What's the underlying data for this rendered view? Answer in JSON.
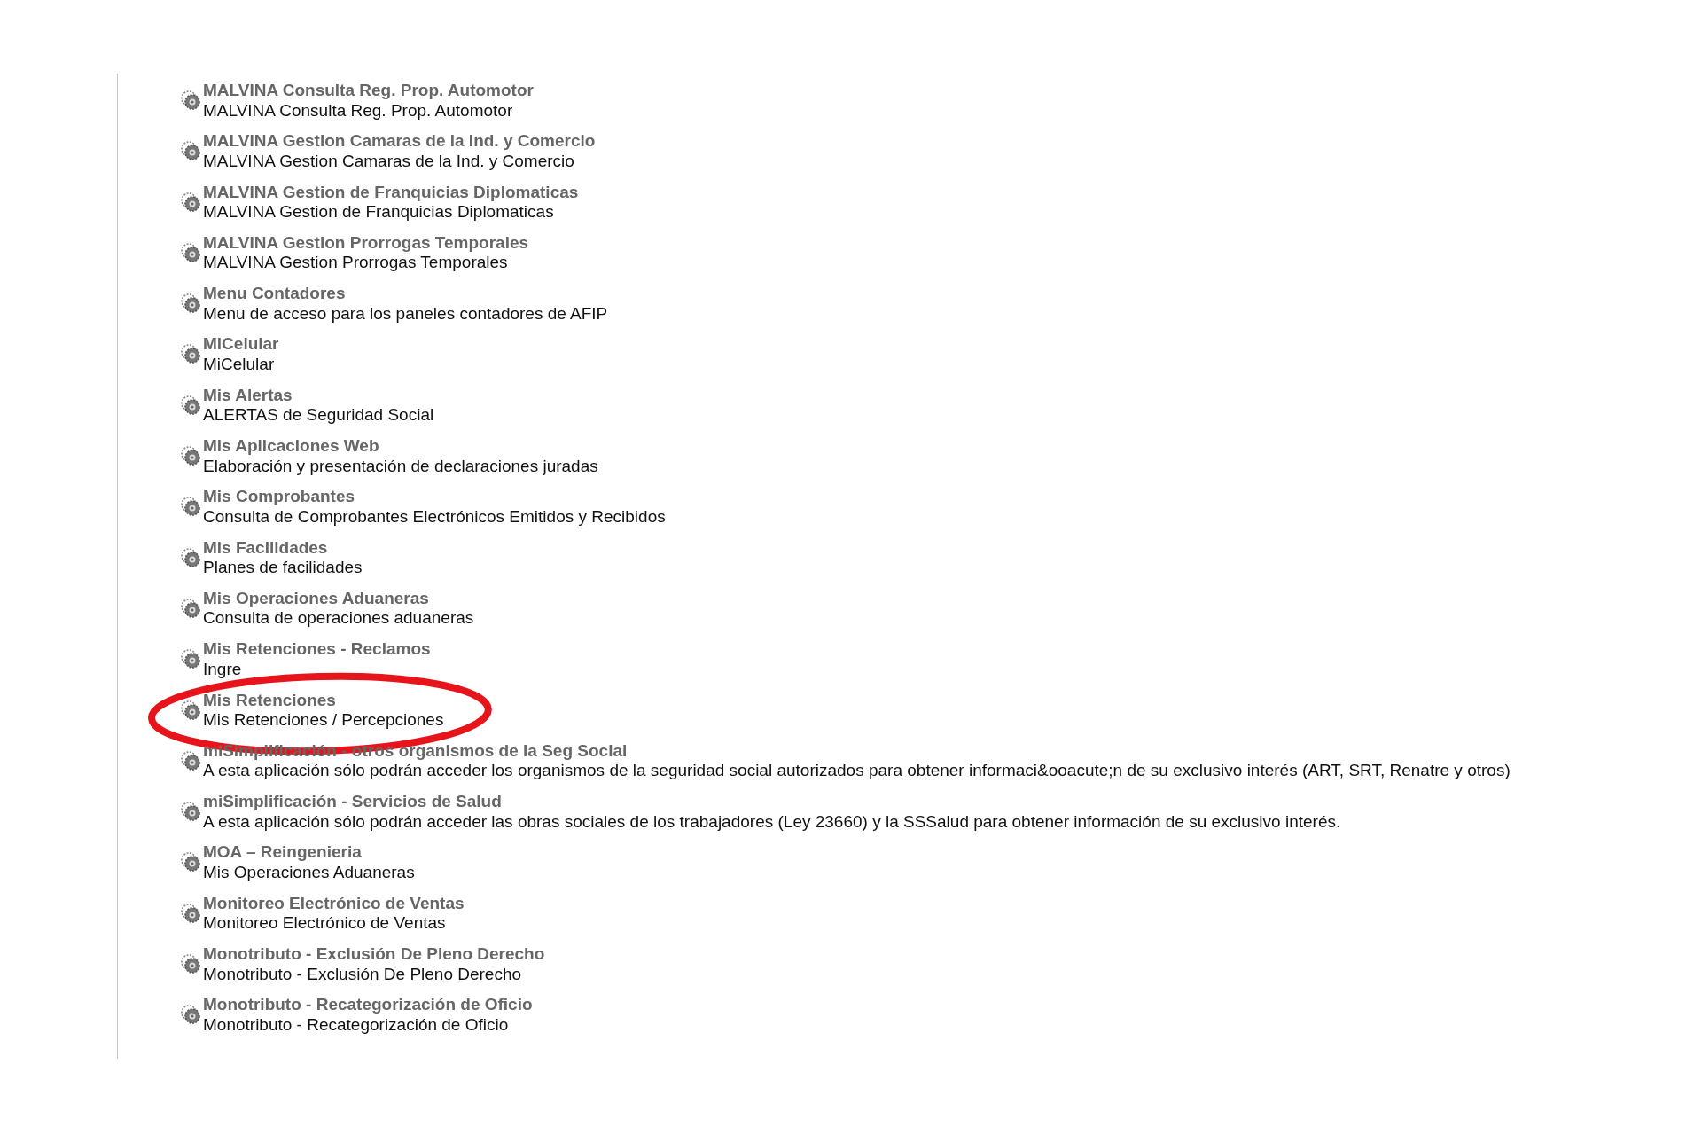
{
  "items": [
    {
      "title": "MALVINA Consulta Reg. Prop. Automotor",
      "description": "MALVINA Consulta Reg. Prop. Automotor",
      "circled": false
    },
    {
      "title": "MALVINA Gestion Camaras de la Ind. y Comercio",
      "description": "MALVINA Gestion Camaras de la Ind. y Comercio",
      "circled": false
    },
    {
      "title": "MALVINA Gestion de Franquicias Diplomaticas",
      "description": "MALVINA Gestion de Franquicias Diplomaticas",
      "circled": false
    },
    {
      "title": "MALVINA Gestion Prorrogas Temporales",
      "description": "MALVINA Gestion Prorrogas Temporales",
      "circled": false
    },
    {
      "title": "Menu Contadores",
      "description": "Menu de acceso para los paneles contadores de AFIP",
      "circled": false
    },
    {
      "title": "MiCelular",
      "description": "MiCelular",
      "circled": false
    },
    {
      "title": "Mis Alertas",
      "description": "ALERTAS de Seguridad Social",
      "circled": false
    },
    {
      "title": "Mis Aplicaciones Web",
      "description": "Elaboración y presentación de declaraciones juradas",
      "circled": false
    },
    {
      "title": "Mis Comprobantes",
      "description": "Consulta de Comprobantes Electrónicos Emitidos y Recibidos",
      "circled": false
    },
    {
      "title": "Mis Facilidades",
      "description": "Planes de facilidades",
      "circled": false
    },
    {
      "title": "Mis Operaciones Aduaneras",
      "description": "Consulta de operaciones aduaneras",
      "circled": false
    },
    {
      "title": "Mis Retenciones - Reclamos",
      "description": "Ingre",
      "circled": false
    },
    {
      "title": "Mis Retenciones",
      "description": "Mis Retenciones / Percepciones",
      "circled": true
    },
    {
      "title": "miSimplificación - otros organismos de la Seg Social",
      "description": "A esta aplicación sólo podrán acceder los organismos de la seguridad social autorizados para obtener informaci&ooacute;n de su exclusivo interés (ART, SRT, Renatre y otros)",
      "circled": false
    },
    {
      "title": "miSimplificación - Servicios de Salud",
      "description": "A esta aplicación sólo podrán acceder las obras sociales de los trabajadores (Ley 23660) y la SSSalud para obtener información de su exclusivo interés.",
      "circled": false
    },
    {
      "title": "MOA – Reingenieria",
      "description": "Mis Operaciones Aduaneras",
      "circled": false
    },
    {
      "title": "Monitoreo Electrónico de Ventas",
      "description": "Monitoreo Electrónico de Ventas",
      "circled": false
    },
    {
      "title": "Monotributo - Exclusión De Pleno Derecho",
      "description": "Monotributo - Exclusión De Pleno Derecho",
      "circled": false
    },
    {
      "title": "Monotributo - Recategorización de Oficio",
      "description": "Monotributo - Recategorización de Oficio",
      "circled": false
    }
  ]
}
